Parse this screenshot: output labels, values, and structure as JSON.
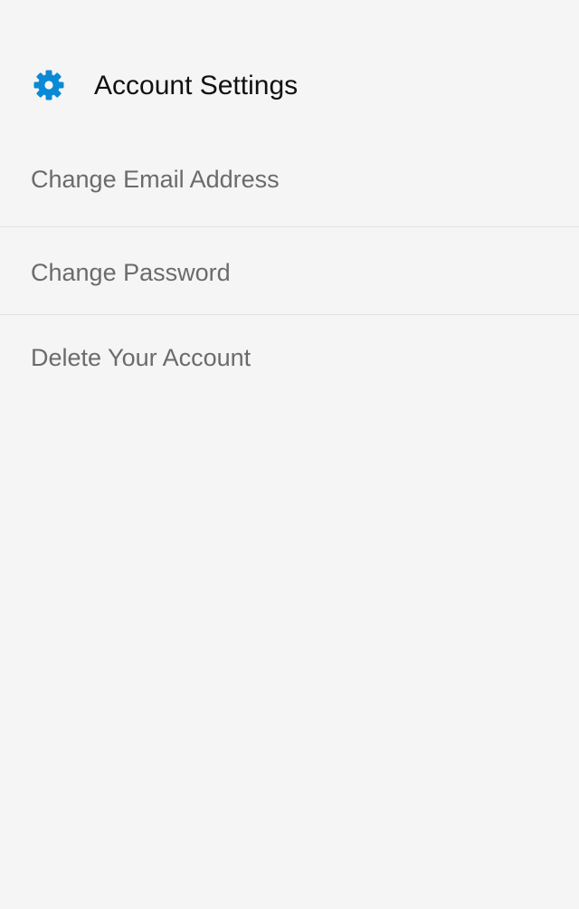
{
  "header": {
    "title": "Account Settings",
    "icon": "gear-icon",
    "accent_color": "#0a8ad6"
  },
  "menu": {
    "items": [
      {
        "label": "Change Email Address"
      },
      {
        "label": "Change Password"
      },
      {
        "label": "Delete Your Account"
      }
    ]
  },
  "colors": {
    "background": "#f5f5f5",
    "item_text": "#6b6b6b",
    "title_text": "#111111",
    "divider": "#e2e2e2"
  }
}
